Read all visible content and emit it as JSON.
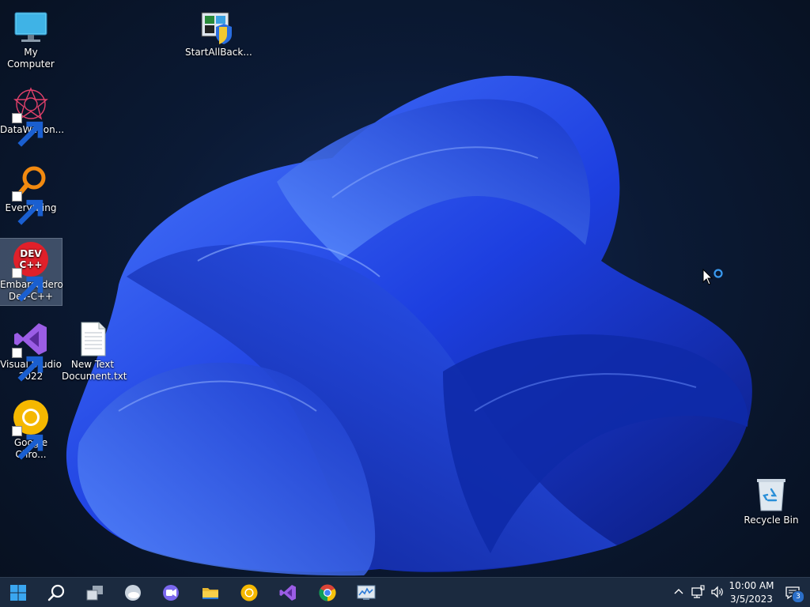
{
  "desktop": {
    "icons": [
      {
        "label": "My Computer"
      },
      {
        "label": "StartAllBack..."
      },
      {
        "label": "DataWagon..."
      },
      {
        "label": "Everything"
      },
      {
        "label": "Embarcadero Dev-C++"
      },
      {
        "label": "Visual Studio 2022"
      },
      {
        "label": "New Text Document.txt"
      },
      {
        "label": "Google Chro..."
      },
      {
        "label": "Recycle Bin"
      }
    ]
  },
  "taskbar": {
    "buttons": [
      {
        "icon": "windows-start-icon"
      },
      {
        "icon": "search-icon"
      },
      {
        "icon": "task-view-icon"
      },
      {
        "icon": "weather-widget-icon"
      },
      {
        "icon": "teams-chat-icon"
      },
      {
        "icon": "file-explorer-icon"
      },
      {
        "icon": "chrome-canary-icon"
      },
      {
        "icon": "visual-studio-icon"
      },
      {
        "icon": "chrome-icon"
      },
      {
        "icon": "resource-monitor-icon"
      }
    ],
    "tray": {
      "time": "10:00 AM",
      "date": "3/5/2023",
      "notification_count": "3"
    }
  },
  "colors": {
    "taskbar_bg": "#1b2a3f",
    "wallpaper_accent": "#1f45e6"
  }
}
